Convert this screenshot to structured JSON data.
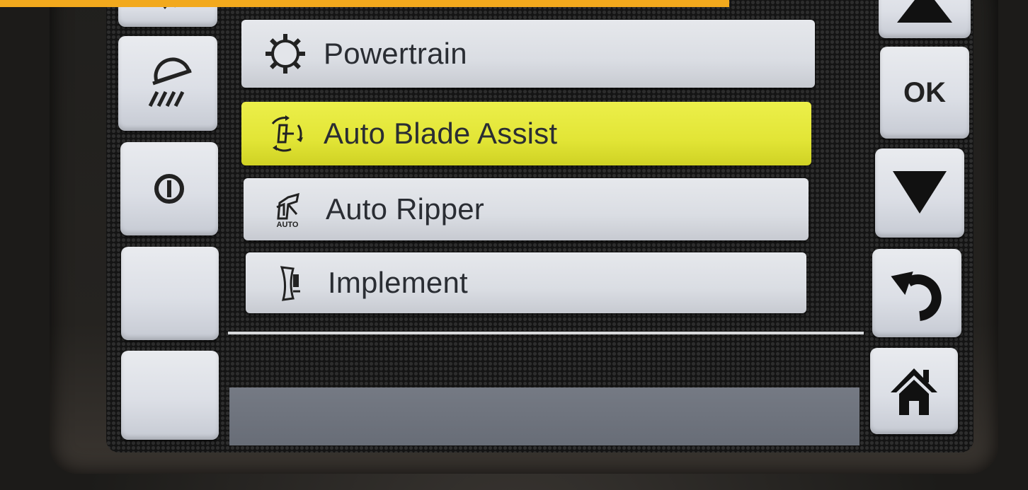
{
  "menu": {
    "items": [
      {
        "label": "Powertrain",
        "icon": "gear-icon",
        "selected": false
      },
      {
        "label": "Auto Blade Assist",
        "icon": "blade-assist-icon",
        "selected": true
      },
      {
        "label": "Auto Ripper",
        "icon": "auto-ripper-icon",
        "selected": false
      },
      {
        "label": "Implement",
        "icon": "implement-icon",
        "selected": false
      }
    ],
    "auto_ripper_icon_caption": "AUTO"
  },
  "right_keys": {
    "ok_label": "OK",
    "icons": [
      "up-arrow-icon",
      "down-arrow-icon",
      "back-icon",
      "home-icon"
    ]
  },
  "left_keys": {
    "icons": [
      "work-light-icon",
      "power-icon"
    ]
  },
  "colors": {
    "selection": "#e2e536",
    "key_face": "#dcdfe6",
    "banner": "#f2a91d",
    "status_bar": "#6c717b"
  }
}
